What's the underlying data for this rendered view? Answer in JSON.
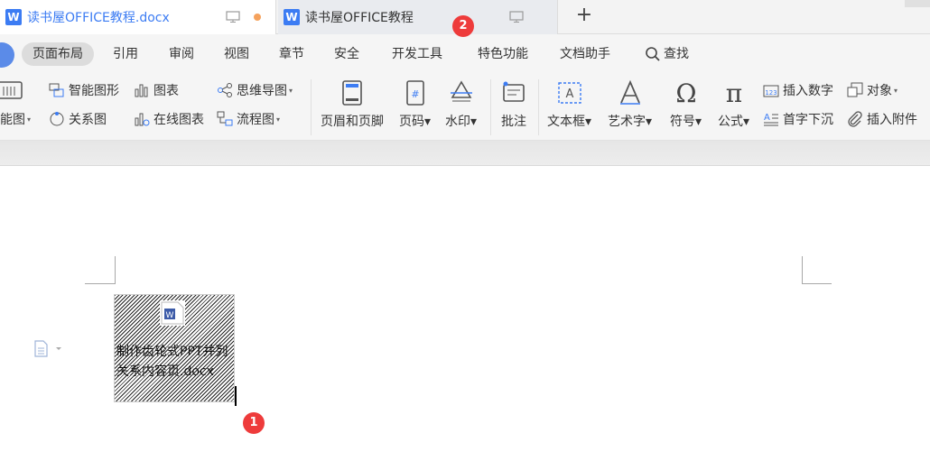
{
  "tabs": [
    {
      "title": "读书屋OFFICE教程.docx",
      "icon": "W"
    },
    {
      "title": "读书屋OFFICE教程",
      "icon": "W"
    }
  ],
  "menu": {
    "items": [
      "页面布局",
      "引用",
      "审阅",
      "视图",
      "章节",
      "安全",
      "开发工具",
      "特色功能",
      "文档助手"
    ],
    "active": "页面布局",
    "search_label": "查找"
  },
  "ribbon": {
    "smartart": "能图",
    "smart_shape": "智能图形",
    "chart": "图表",
    "mindmap": "思维导图",
    "relation": "关系图",
    "online_chart": "在线图表",
    "flowchart": "流程图",
    "header_footer": "页眉和页脚",
    "page_num": "页码",
    "watermark": "水印",
    "comment": "批注",
    "textbox": "文本框",
    "wordart": "艺术字",
    "symbol": "符号",
    "formula": "公式",
    "insert_number": "插入数字",
    "object": "对象",
    "drop_cap": "首字下沉",
    "attachment": "插入附件"
  },
  "document": {
    "embedded_filename": "制作齿轮式PPT并列关系内容页.docx"
  },
  "badges": {
    "b1": "1",
    "b2": "2"
  },
  "colors": {
    "accent": "#3c7cf3",
    "badge": "#ee3b3b",
    "modified_dot": "#f5a25d"
  }
}
